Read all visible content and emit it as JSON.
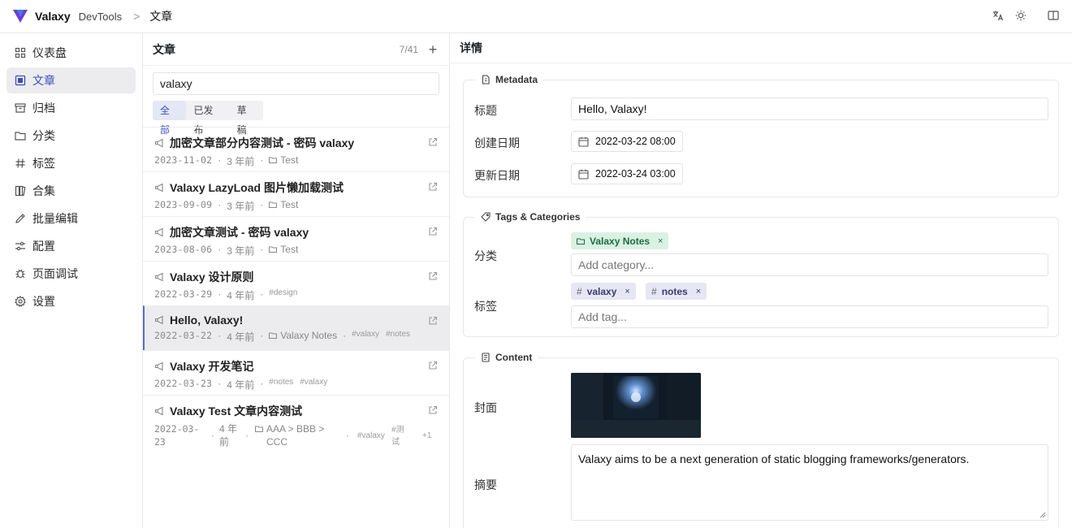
{
  "header": {
    "brand": "Valaxy",
    "subtitle": "DevTools",
    "separator": ">",
    "page": "文章",
    "icons": [
      "translate-icon",
      "sun-icon",
      "book-open-icon"
    ],
    "accent": "#5a6bd1"
  },
  "sidebar": {
    "items": [
      {
        "label": "仪表盘",
        "icon": "dashboard-icon"
      },
      {
        "label": "文章",
        "icon": "article-icon",
        "active": true
      },
      {
        "label": "归档",
        "icon": "archive-icon"
      },
      {
        "label": "分类",
        "icon": "folder-icon"
      },
      {
        "label": "标签",
        "icon": "hash-icon"
      },
      {
        "label": "合集",
        "icon": "collection-icon"
      },
      {
        "label": "批量编辑",
        "icon": "pencil-icon"
      },
      {
        "label": "配置",
        "icon": "sliders-icon"
      },
      {
        "label": "页面调试",
        "icon": "bug-icon"
      },
      {
        "label": "设置",
        "icon": "gear-icon"
      }
    ]
  },
  "postlist": {
    "title": "文章",
    "count": "7/41",
    "add": "+",
    "search_value": "valaxy",
    "filters": [
      "全部",
      "已发布",
      "草稿"
    ],
    "posts": [
      {
        "title": "加密文章部分内容测试 - 密码 valaxy",
        "date": "2023-11-02",
        "ago": "3 年前",
        "category": "Test",
        "tags": []
      },
      {
        "title": "Valaxy LazyLoad 图片懒加载测试",
        "date": "2023-09-09",
        "ago": "3 年前",
        "category": "Test",
        "tags": []
      },
      {
        "title": "加密文章测试 - 密码 valaxy",
        "date": "2023-08-06",
        "ago": "3 年前",
        "category": "Test",
        "tags": []
      },
      {
        "title": "Valaxy 设计原则",
        "date": "2022-03-29",
        "ago": "4 年前",
        "category": "",
        "tags": [
          "#design"
        ]
      },
      {
        "title": "Hello, Valaxy!",
        "date": "2022-03-22",
        "ago": "4 年前",
        "category": "Valaxy Notes",
        "tags": [
          "#valaxy",
          "#notes"
        ],
        "active": true
      },
      {
        "title": "Valaxy 开发笔记",
        "date": "2022-03-23",
        "ago": "4 年前",
        "category": "",
        "tags": [
          "#notes",
          "#valaxy"
        ]
      },
      {
        "title": "Valaxy Test 文章内容测试",
        "date_line1": "2022-03-",
        "date_line2": "23",
        "ago_line1": "4 年",
        "ago_line2": "前",
        "cat_line1": "AAA > BBB >",
        "cat_line2": "CCC",
        "tag1": "#valaxy",
        "tag2_line1": "#测",
        "tag2_line2": "试",
        "more": "+1"
      }
    ]
  },
  "detail": {
    "title": "详情",
    "metadata": {
      "legend": "Metadata",
      "title_label": "标题",
      "title_value": "Hello, Valaxy!",
      "created_label": "创建日期",
      "created_value": "2022-03-22 08:00",
      "updated_label": "更新日期",
      "updated_value": "2022-03-24 03:00"
    },
    "tags_categories": {
      "legend": "Tags & Categories",
      "category_label": "分类",
      "categories": [
        "Valaxy Notes"
      ],
      "category_placeholder": "Add category...",
      "tag_label": "标签",
      "tags": [
        "valaxy",
        "notes"
      ],
      "tag_placeholder": "Add tag...",
      "remove": "×",
      "hash": "#"
    },
    "content": {
      "legend": "Content",
      "cover_label": "封面",
      "excerpt_label": "摘要",
      "excerpt_value": "Valaxy aims to be a next generation of static blogging frameworks/generators."
    }
  }
}
